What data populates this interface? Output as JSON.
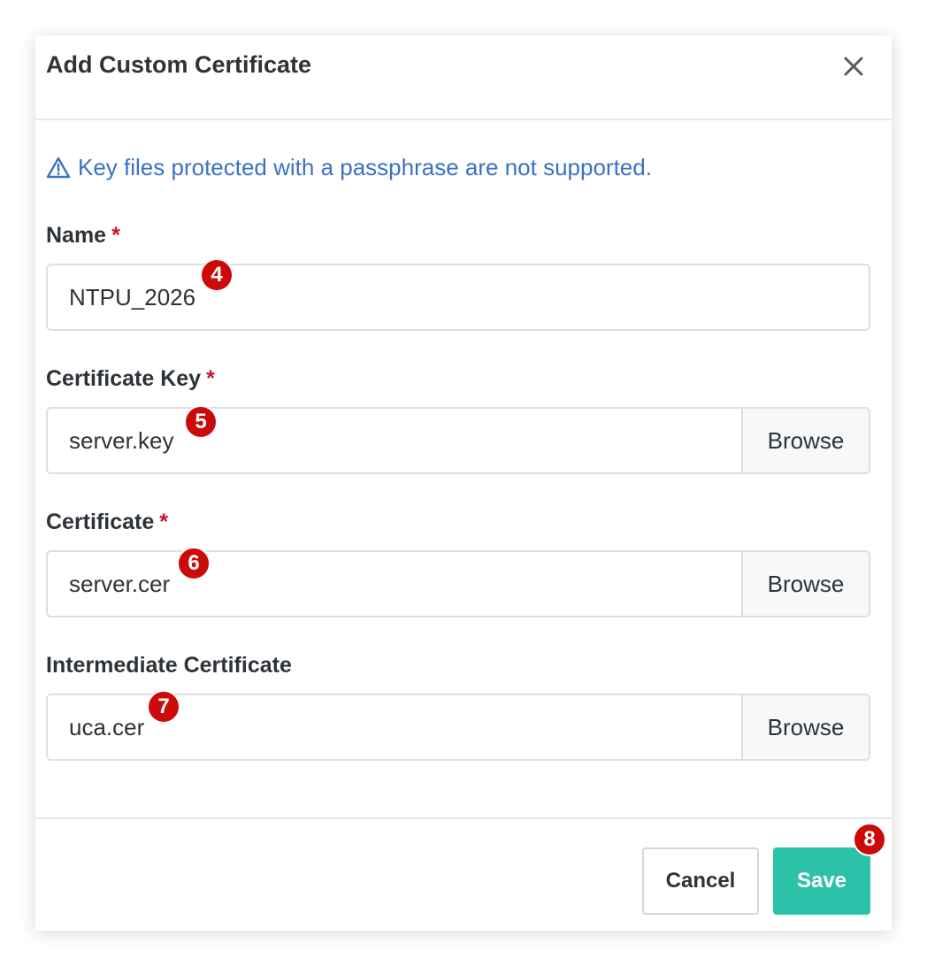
{
  "dialog": {
    "title": "Add Custom Certificate",
    "warning": "Key files protected with a passphrase are not supported."
  },
  "fields": {
    "name": {
      "label": "Name",
      "required_mark": "*",
      "value": "NTPU_2026"
    },
    "certificate_key": {
      "label": "Certificate Key",
      "required_mark": "*",
      "value": "server.key",
      "browse_label": "Browse"
    },
    "certificate": {
      "label": "Certificate",
      "required_mark": "*",
      "value": "server.cer",
      "browse_label": "Browse"
    },
    "intermediate_certificate": {
      "label": "Intermediate Certificate",
      "value": "uca.cer",
      "browse_label": "Browse"
    }
  },
  "footer": {
    "cancel_label": "Cancel",
    "save_label": "Save"
  },
  "step_badges": {
    "name": "4",
    "certificate_key": "5",
    "certificate": "6",
    "intermediate_certificate": "7",
    "save": "8"
  },
  "icons": {
    "close": "close-icon",
    "warning": "warning-icon"
  },
  "colors": {
    "accent_save": "#2cc2a8",
    "warning_text": "#3a72c4",
    "required": "#c8102e",
    "badge": "#cc0a0a"
  }
}
